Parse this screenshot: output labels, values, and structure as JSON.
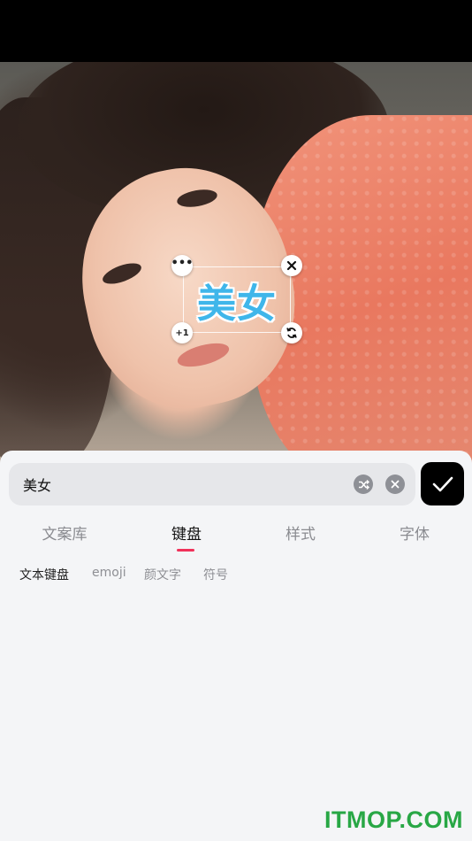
{
  "overlay": {
    "text": "美女",
    "text_color": "#3fb6ea",
    "handles": {
      "more_icon": "ellipsis-icon",
      "close_icon": "close-icon",
      "copy_label": "+1",
      "rotate_icon": "rotate-icon"
    }
  },
  "editor": {
    "input_value": "美女",
    "shuffle_icon": "shuffle-icon",
    "clear_icon": "clear-icon",
    "confirm_icon": "checkmark-icon",
    "tabs": [
      {
        "label": "文案库",
        "active": false
      },
      {
        "label": "键盘",
        "active": true
      },
      {
        "label": "样式",
        "active": false
      },
      {
        "label": "字体",
        "active": false
      }
    ],
    "accent_color": "#f0325a",
    "subtabs": [
      {
        "label": "文本键盘",
        "active": true
      },
      {
        "label": "emoji",
        "active": false
      },
      {
        "label": "颜文字",
        "active": false
      },
      {
        "label": "符号",
        "active": false
      }
    ]
  },
  "watermark": {
    "text": "ITMOP.COM",
    "color": "#28a745"
  }
}
